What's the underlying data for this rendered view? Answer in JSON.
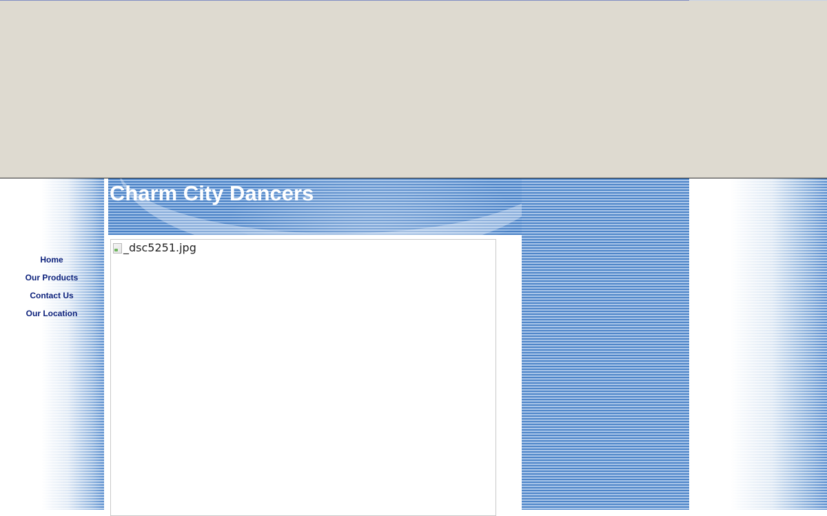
{
  "header": {
    "site_title": "Charm City Dancers"
  },
  "nav": {
    "items": [
      {
        "label": "Home"
      },
      {
        "label": "Our Products"
      },
      {
        "label": "Contact Us"
      },
      {
        "label": "Our Location"
      }
    ]
  },
  "main": {
    "image_alt": "_dsc5251.jpg"
  },
  "colors": {
    "top_band": "#dedad0",
    "stripe_blue": "#4f86c9",
    "stripe_light": "#a9c5e8",
    "nav_link": "#0a1f7a",
    "title_text": "#ffffff"
  }
}
